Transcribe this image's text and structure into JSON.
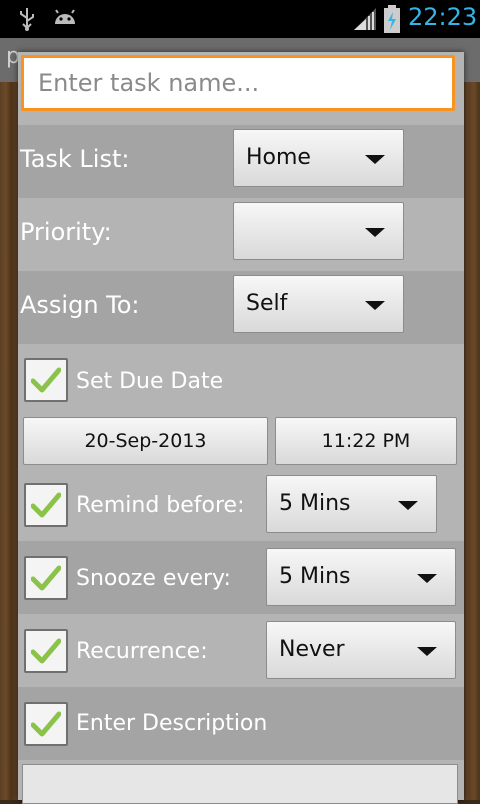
{
  "status_bar": {
    "time": "22:23",
    "icons": [
      "usb-icon",
      "android-icon",
      "signal-icon",
      "battery-charging-icon"
    ]
  },
  "background_app": {
    "title_fragment": "p"
  },
  "dialog": {
    "task_name": {
      "value": "",
      "placeholder": "Enter task name..."
    },
    "task_list": {
      "label": "Task List:",
      "value": "Home"
    },
    "priority": {
      "label": "Priority:",
      "value": ""
    },
    "assign_to": {
      "label": "Assign To:",
      "value": "Self"
    },
    "set_due_date": {
      "label": "Set Due Date",
      "checked": true
    },
    "due_date": {
      "date": "20-Sep-2013",
      "time": "11:22 PM"
    },
    "remind_before": {
      "label": "Remind before:",
      "checked": true,
      "value": "5 Mins"
    },
    "snooze_every": {
      "label": "Snooze every:",
      "checked": true,
      "value": "5 Mins"
    },
    "recurrence": {
      "label": "Recurrence:",
      "checked": true,
      "value": "Never"
    },
    "enter_description": {
      "label": "Enter Description",
      "checked": true
    }
  },
  "colors": {
    "focus_border": "#f7931e",
    "clock": "#33b5e5",
    "check": "#8bc34a"
  }
}
